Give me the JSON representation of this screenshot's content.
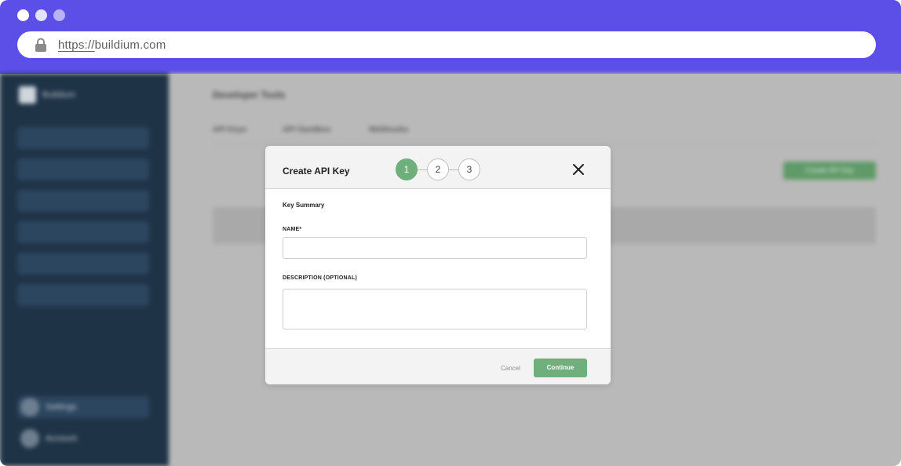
{
  "browser": {
    "url_scheme": "https://",
    "url_host": "buildium.com",
    "lock_icon": "lock-icon"
  },
  "background_app": {
    "brand": "Buildium",
    "page_title": "Developer Tools",
    "tabs": [
      "API Keys",
      "API Sandbox",
      "Webhooks"
    ],
    "create_button": "Create API Key",
    "sidebar_footer": {
      "settings": "Settings",
      "account": "Account"
    }
  },
  "modal": {
    "title": "Create API Key",
    "steps": [
      "1",
      "2",
      "3"
    ],
    "active_step": 1,
    "close_icon": "close-icon",
    "section_title": "Key Summary",
    "name_label": "NAME*",
    "name_value": "",
    "description_label": "DESCRIPTION (OPTIONAL)",
    "description_value": "",
    "cancel_label": "Cancel",
    "continue_label": "Continue"
  },
  "colors": {
    "chrome": "#5b4fe8",
    "accent_green": "#6eaf7b",
    "sidebar": "#1f3347"
  }
}
